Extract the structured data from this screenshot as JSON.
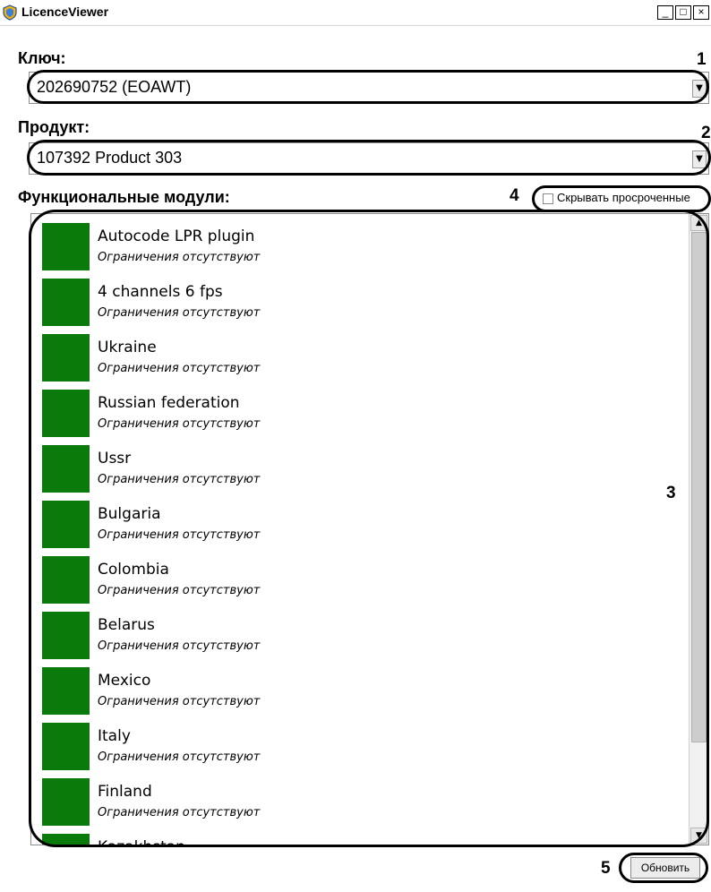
{
  "window": {
    "title": "LicenceViewer",
    "controls": {
      "minimize": "_",
      "maximize": "□",
      "close": "×"
    }
  },
  "key": {
    "label": "Ключ:",
    "value": "202690752 (EOAWT)",
    "callout": "1"
  },
  "product": {
    "label": "Продукт:",
    "value": "107392 Product 303",
    "callout": "2"
  },
  "modules": {
    "label": "Функциональные модули:",
    "callout": "3",
    "swatch_color": "#0a7a0a",
    "items": [
      {
        "name": "Autocode LPR plugin",
        "restriction": "Ограничения отсутствуют"
      },
      {
        "name": "4 channels 6 fps",
        "restriction": "Ограничения отсутствуют"
      },
      {
        "name": "Ukraine",
        "restriction": "Ограничения отсутствуют"
      },
      {
        "name": "Russian federation",
        "restriction": "Ограничения отсутствуют"
      },
      {
        "name": "Ussr",
        "restriction": "Ограничения отсутствуют"
      },
      {
        "name": "Bulgaria",
        "restriction": "Ограничения отсутствуют"
      },
      {
        "name": "Colombia",
        "restriction": "Ограничения отсутствуют"
      },
      {
        "name": "Belarus",
        "restriction": "Ограничения отсутствуют"
      },
      {
        "name": "Mexico",
        "restriction": "Ограничения отсутствуют"
      },
      {
        "name": "Italy",
        "restriction": "Ограничения отсутствуют"
      },
      {
        "name": "Finland",
        "restriction": "Ограничения отсутствуют"
      },
      {
        "name": "Kazakhstan",
        "restriction": ""
      }
    ]
  },
  "hide_expired": {
    "label": "Скрывать просроченные",
    "checked": false,
    "callout": "4"
  },
  "refresh": {
    "label": "Обновить",
    "callout": "5"
  }
}
